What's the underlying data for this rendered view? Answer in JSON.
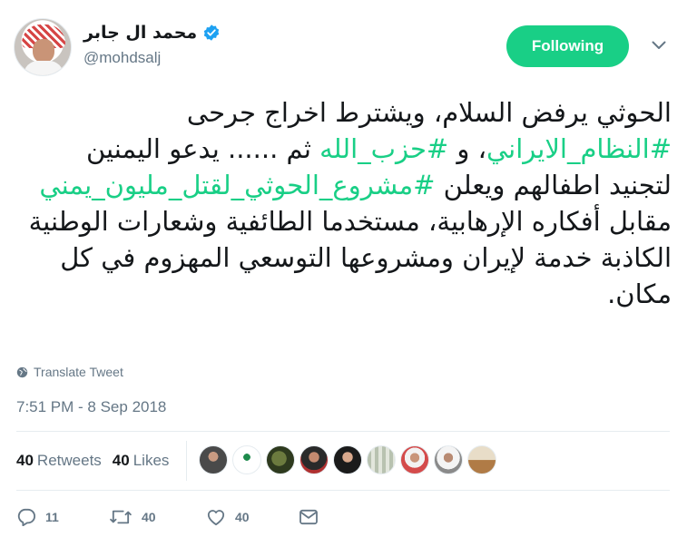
{
  "author": {
    "display_name": "محمد ال جابر",
    "handle": "@mohdsalj",
    "verified": true
  },
  "follow_button_label": "Following",
  "tweet": {
    "segments": [
      {
        "text": "الحوثي يرفض السلام، ويشترط اخراج جرحى ",
        "type": "text"
      },
      {
        "text": "#النظام_الايراني",
        "type": "hashtag"
      },
      {
        "text": "، و ",
        "type": "text"
      },
      {
        "text": "#حزب_الله",
        "type": "hashtag"
      },
      {
        "text": " ثم ...... يدعو اليمنين لتجنيد اطفالهم ويعلن ",
        "type": "text"
      },
      {
        "text": "#مشروع_الحوثي_لقتل_مليون_يمني",
        "type": "hashtag"
      },
      {
        "text": " مقابل أفكاره الإرهابية، مستخدما الطائفية وشعارات الوطنية الكاذبة خدمة لإيران ومشروعها التوسعي المهزوم في كل مكان.",
        "type": "text"
      }
    ],
    "translate_label": "Translate Tweet",
    "timestamp": "7:51 PM - 8 Sep 2018"
  },
  "stats": {
    "retweets_count": "40",
    "retweets_label": "Retweets",
    "likes_count": "40",
    "likes_label": "Likes"
  },
  "actions": {
    "reply_count": "11",
    "retweet_count": "40",
    "like_count": "40"
  },
  "colors": {
    "accent": "#19cf86",
    "secondary_text": "#657786",
    "verified_blue": "#1da1f2"
  },
  "icons": [
    "verified-badge-icon",
    "chevron-down-icon",
    "globe-icon",
    "reply-icon",
    "retweet-icon",
    "heart-icon",
    "envelope-icon"
  ]
}
